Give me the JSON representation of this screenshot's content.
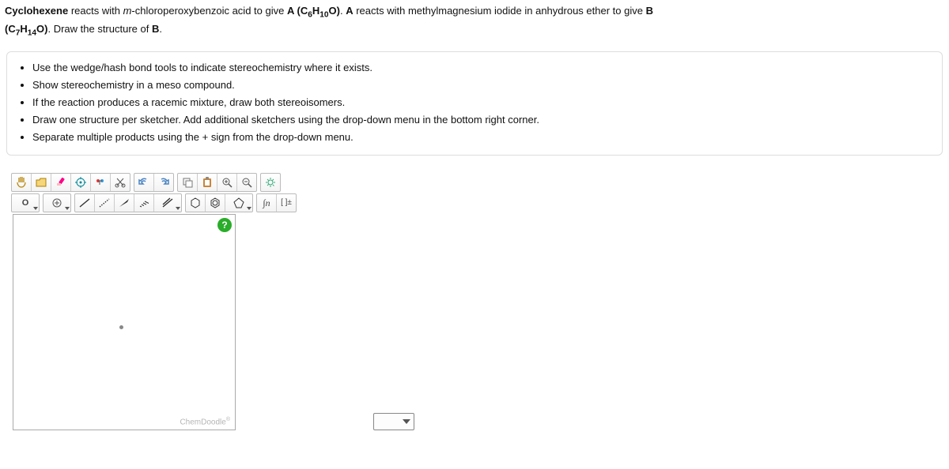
{
  "question": {
    "l1a": "Cyclohexene",
    "l1b": " reacts with ",
    "l1c": "m",
    "l1d": "-chloroperoxybenzoic acid to give ",
    "l1e": "A (C",
    "sub1a": "6",
    "l1f": "H",
    "sub1b": "10",
    "l1g": "O)",
    "l1h": ". ",
    "l1i": "A",
    "l1j": " reacts with methylmagnesium iodide in anhydrous ether to give ",
    "l1k": "B",
    "l2a": "(C",
    "sub2a": "7",
    "l2b": "H",
    "sub2b": "14",
    "l2c": "O)",
    "l2d": ". Draw the structure of ",
    "l2e": "B",
    "l2f": "."
  },
  "rubric": {
    "i0": "Use the wedge/hash bond tools to indicate stereochemistry where it exists.",
    "i1": "Show stereochemistry in a meso compound.",
    "i2": "If the reaction produces a racemic mixture, draw both stereoisomers.",
    "i3": "Draw one structure per sketcher. Add additional sketchers using the drop-down menu in the bottom right corner.",
    "i4": "Separate multiple products using the + sign from the drop-down menu."
  },
  "toolbar": {
    "pan": "✋",
    "open": "📂",
    "erase": "✏️",
    "center": "✳",
    "cleanA": "⚛",
    "cleanB": "✂",
    "undo": "↶",
    "redo": "↷",
    "copy": "⧉",
    "paste": "📋",
    "zoomIn": "🔍+",
    "zoomOut": "🔍−",
    "settings": "⚙",
    "atomO": "O",
    "charge": "⊕",
    "single": "",
    "dotted": "",
    "wedge": "",
    "hash": "",
    "multi": "",
    "ring6": "",
    "ring5": "",
    "ring4": "",
    "sn": "∫n",
    "bracket": "[ ]±"
  },
  "canvas": {
    "help": "?",
    "watermark": "ChemDoodle",
    "wmSym": "®"
  },
  "dropdown": {
    "selected": ""
  }
}
